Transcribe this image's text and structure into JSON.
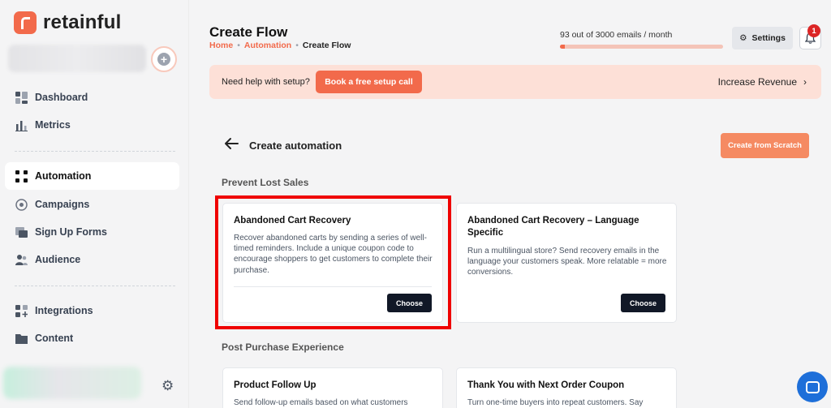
{
  "app": {
    "brand": "retainful",
    "accent": "#f26a4b"
  },
  "sidebar": {
    "items": [
      {
        "label": "Dashboard",
        "icon": "dashboard-icon"
      },
      {
        "label": "Metrics",
        "icon": "bar-chart-icon"
      },
      {
        "label": "Automation",
        "icon": "automation-icon",
        "active": true
      },
      {
        "label": "Campaigns",
        "icon": "megaphone-icon"
      },
      {
        "label": "Sign Up Forms",
        "icon": "form-icon"
      },
      {
        "label": "Audience",
        "icon": "users-icon"
      },
      {
        "label": "Integrations",
        "icon": "integrations-icon"
      },
      {
        "label": "Content",
        "icon": "folder-icon"
      }
    ]
  },
  "header": {
    "title": "Create Flow",
    "breadcrumb": [
      "Home",
      "Automation",
      "Create Flow"
    ],
    "usage_text": "93 out of 3000 emails / month",
    "usage_fraction": 0.031,
    "settings_label": "Settings",
    "notification_count": "1"
  },
  "help_banner": {
    "text": "Need help with setup?",
    "button": "Book a free setup call",
    "right_link": "Increase Revenue"
  },
  "main": {
    "title": "Create automation",
    "scratch_button": "Create from Scratch",
    "sections": [
      {
        "title": "Prevent Lost Sales",
        "cards": [
          {
            "title": "Abandoned Cart Recovery",
            "description": "Recover abandoned carts by sending a series of well-timed reminders. Include a unique coupon code to encourage shoppers to get customers to complete their purchase.",
            "button": "Choose"
          },
          {
            "title": "Abandoned Cart Recovery – Language Specific",
            "description": "Run a multilingual store? Send recovery emails in the language your customers speak. More relatable = more conversions.",
            "button": "Choose"
          }
        ]
      },
      {
        "title": "Post Purchase Experience",
        "cards": [
          {
            "title": "Product Follow Up",
            "description": "Send follow-up emails based on what customers"
          },
          {
            "title": "Thank You with Next Order Coupon",
            "description": "Turn one-time buyers into repeat customers. Say"
          }
        ]
      }
    ]
  }
}
